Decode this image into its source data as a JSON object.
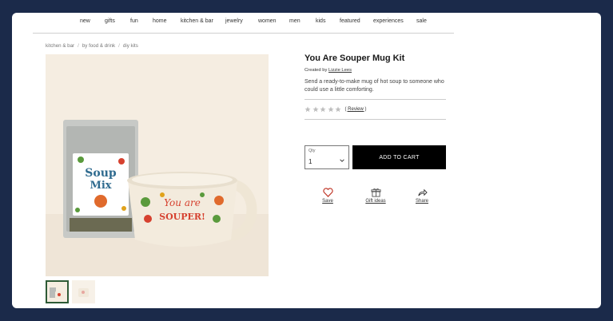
{
  "nav": {
    "items": [
      "new",
      "gifts",
      "fun",
      "home",
      "kitchen & bar",
      "jewelry",
      "women",
      "men",
      "kids",
      "featured",
      "experiences",
      "sale"
    ]
  },
  "breadcrumb": [
    "kitchen & bar",
    "by food & drink",
    "diy kits"
  ],
  "product": {
    "title": "You Are Souper Mug Kit",
    "creator_prefix": "Created by",
    "creator_name": "Lizzie Lees",
    "description": "Send a ready-to-make mug of hot soup to someone who could use a little comforting.",
    "rating": 0,
    "rating_max": 5,
    "reviews_text": "( Review )"
  },
  "hero": {
    "packet_line1": "Soup",
    "packet_line2": "Mix",
    "mug_line1": "You are",
    "mug_line2": "SOUPER!"
  },
  "purchase": {
    "qty_label": "Qty",
    "qty_value": "1",
    "add_to_cart": "ADD TO CART"
  },
  "actions": {
    "save": "Save",
    "gift_ideas": "Gift ideas",
    "share": "Share"
  },
  "colors": {
    "frame": "#1b2a4a",
    "button": "#000000",
    "accent_heart": "#c0392b",
    "thumb_border": "#2e5b36"
  }
}
